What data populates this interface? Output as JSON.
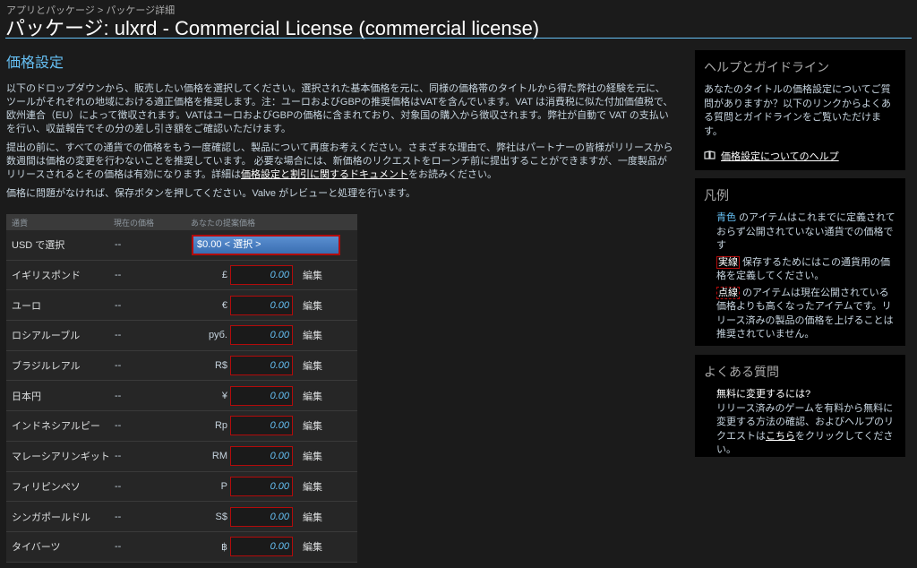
{
  "breadcrumb": {
    "part1": "アプリとパッケージ",
    "sep": " > ",
    "part2": "パッケージ詳細"
  },
  "page_title": "パッケージ: ulxrd - Commercial License (commercial license)",
  "pricing": {
    "heading": "価格設定",
    "para1": "以下のドロップダウンから、販売したい価格を選択してください。選択された基本価格を元に、同様の価格帯のタイトルから得た弊社の経験を元に、ツールがそれぞれの地域における適正価格を推奨します。注：ユーロおよびGBPの推奨価格はVATを含んでいます。VAT は消費税に似た付加価値税で、欧州連合（EU）によって徴収されます。VATはユーロおよびGBPの価格に含まれており、対象国の購入から徴収されます。弊社が自動で VAT の支払いを行い、収益報告でその分の差し引き額をご確認いただけます。",
    "para2_pre": "提出の前に、すべての通貨での価格をもう一度確認し、製品について再度お考えください。さまざまな理由で、弊社はパートナーの皆様がリリースから数週間は価格の変更を行わないことを推奨しています。 必要な場合には、新価格のリクエストをローンチ前に提出することができますが、一度製品がリリースされるとその価格は有効になります。詳細は",
    "para2_link": "価格設定と割引に関するドキュメント",
    "para2_post": "をお読みください。",
    "para3": "価格に問題がなければ、保存ボタンを押してください。Valve がレビューと処理を行います。"
  },
  "table": {
    "headers": {
      "currency": "通貨",
      "current": "現在の価格",
      "proposed": "あなたの提案価格"
    },
    "usd": {
      "name": "USD で選択",
      "current": "--",
      "select_value": "$0.00 < 選択 >"
    },
    "rows": [
      {
        "name": "イギリスポンド",
        "current": "--",
        "symbol": "£",
        "value": "0.00",
        "edit": "編集"
      },
      {
        "name": "ユーロ",
        "current": "--",
        "symbol": "€",
        "value": "0.00",
        "edit": "編集"
      },
      {
        "name": "ロシアルーブル",
        "current": "--",
        "symbol": "руб.",
        "value": "0.00",
        "edit": "編集"
      },
      {
        "name": "ブラジルレアル",
        "current": "--",
        "symbol": "R$",
        "value": "0.00",
        "edit": "編集"
      },
      {
        "name": "日本円",
        "current": "--",
        "symbol": "¥",
        "value": "0.00",
        "edit": "編集"
      },
      {
        "name": "インドネシアルピー",
        "current": "--",
        "symbol": "Rp",
        "value": "0.00",
        "edit": "編集"
      },
      {
        "name": "マレーシアリンギット",
        "current": "--",
        "symbol": "RM",
        "value": "0.00",
        "edit": "編集"
      },
      {
        "name": "フィリピンペソ",
        "current": "--",
        "symbol": "P",
        "value": "0.00",
        "edit": "編集"
      },
      {
        "name": "シンガポールドル",
        "current": "--",
        "symbol": "S$",
        "value": "0.00",
        "edit": "編集"
      },
      {
        "name": "タイバーツ",
        "current": "--",
        "symbol": "฿",
        "value": "0.00",
        "edit": "編集"
      }
    ]
  },
  "help": {
    "title": "ヘルプとガイドライン",
    "text": "あなたのタイトルの価格設定についてご質問がありますか？以下のリンクからよくある質問とガイドラインをご覧いただけます。",
    "link": "価格設定についてのヘルプ"
  },
  "legend": {
    "title": "凡例",
    "blue_label": "青色",
    "blue_text": " のアイテムはこれまでに定義されておらず公開されていない通貨での価格です",
    "solid_label": "実線",
    "solid_text": " 保存するためにはこの通貨用の価格を定義してください。",
    "dot_label": "点線",
    "dot_text": " のアイテムは現在公開されている価格よりも高くなったアイテムです。リリース済みの製品の価格を上げることは推奨されていません。"
  },
  "faq": {
    "title": "よくある質問",
    "question": "無料に変更するには?",
    "answer_pre": "リリース済みのゲームを有料から無料に変更する方法の確認、およびヘルプのリクエストは",
    "answer_link": "こちら",
    "answer_post": "をクリックしてください。"
  },
  "colors": {
    "accent": "#66c0f4",
    "error_border": "#b20b0b",
    "background": "#1b1b1b"
  }
}
